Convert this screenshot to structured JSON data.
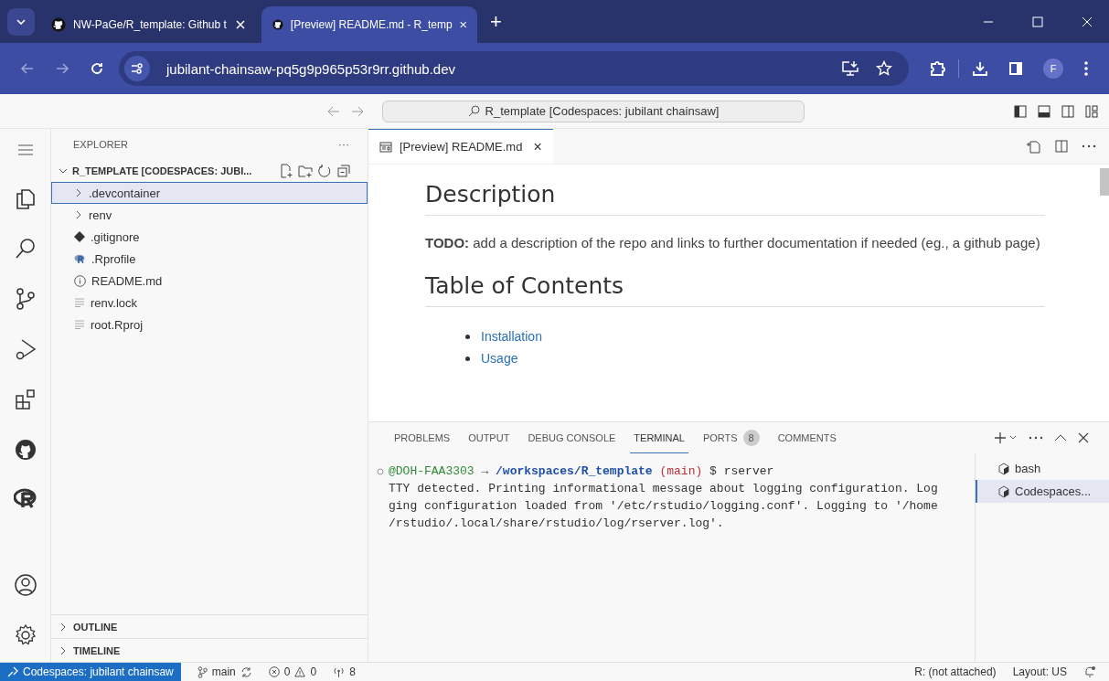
{
  "browser": {
    "tabs": [
      {
        "title": "NW-PaGe/R_template: Github t",
        "selected": false
      },
      {
        "title": "[Preview] README.md - R_temp",
        "selected": true
      }
    ],
    "new_tab": "+",
    "address": "jubilant-chainsaw-pq5g9p965p53r9rr.github.dev",
    "profile": "F"
  },
  "command_center": "R_template [Codespaces: jubilant chainsaw]",
  "explorer": {
    "title": "EXPLORER",
    "more": "···",
    "root": {
      "label": "R_TEMPLATE [CODESPACES: JUBI...",
      "expanded": true,
      "children": [
        {
          "name": ".devcontainer",
          "kind": "folder",
          "selected": true
        },
        {
          "name": "renv",
          "kind": "folder",
          "selected": false
        },
        {
          "name": ".gitignore",
          "kind": "git",
          "selected": false
        },
        {
          "name": ".Rprofile",
          "kind": "r",
          "selected": false
        },
        {
          "name": "README.md",
          "kind": "info",
          "selected": false
        },
        {
          "name": "renv.lock",
          "kind": "text",
          "selected": false
        },
        {
          "name": "root.Rproj",
          "kind": "text",
          "selected": false
        }
      ]
    },
    "sections": [
      {
        "label": "OUTLINE",
        "expanded": false
      },
      {
        "label": "TIMELINE",
        "expanded": false
      }
    ]
  },
  "editor": {
    "tab": {
      "label": "[Preview] README.md",
      "close": "×"
    },
    "preview": [
      {
        "kind": "h1",
        "text": "Description"
      },
      {
        "kind": "p",
        "text": "**TODO:** add a description of the repo and links to further documentation if needed (eg., a github page)"
      },
      {
        "kind": "h1",
        "text": "Table of Contents"
      },
      {
        "kind": "links",
        "items": [
          "Installation",
          "Usage"
        ]
      }
    ]
  },
  "panel": {
    "tabs": [
      {
        "label": "PROBLEMS",
        "selected": false
      },
      {
        "label": "OUTPUT",
        "selected": false
      },
      {
        "label": "DEBUG CONSOLE",
        "selected": false
      },
      {
        "label": "TERMINAL",
        "selected": true
      },
      {
        "label": "PORTS",
        "badge": "8",
        "selected": false
      },
      {
        "label": "COMMENTS",
        "selected": false
      }
    ],
    "prompt": [
      {
        "kind": "user",
        "text": "@DOH-FAA3303"
      },
      {
        "kind": "plain",
        "text": " → "
      },
      {
        "kind": "path",
        "text": "/workspaces/R_template"
      },
      {
        "kind": "branch",
        "text": "(main)"
      },
      {
        "kind": "plain",
        "text": " $ rserver"
      }
    ],
    "output": [
      "TTY detected. Printing informational message about logging configuration. Log",
      "ging configuration loaded from '/etc/rstudio/logging.conf'. Logging to '/home",
      "/rstudio/.local/share/rstudio/log/rserver.log'."
    ],
    "terminals": [
      {
        "name": "bash",
        "selected": false
      },
      {
        "name": "Codespaces...",
        "selected": true
      }
    ]
  },
  "status_bar": {
    "remote": "Codespaces: jubilant chainsaw",
    "branch": "main",
    "errors": "0",
    "warnings": "0",
    "ports": "8",
    "language_server": "R: (not attached)",
    "layout": "Layout: US"
  }
}
